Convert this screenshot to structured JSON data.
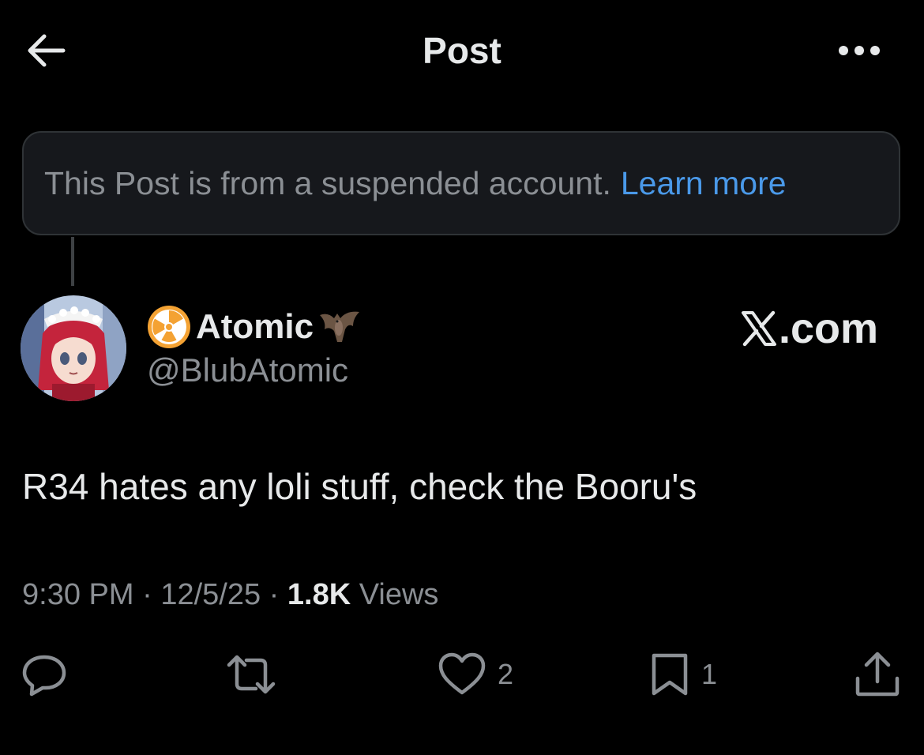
{
  "header": {
    "title": "Post"
  },
  "notice": {
    "text": "This Post is from a suspended account.",
    "link": "Learn more"
  },
  "author": {
    "display_name": "Atomic",
    "handle": "@BlubAtomic",
    "name_emoji_left": "radioactive-icon",
    "name_emoji_right": "bat-icon"
  },
  "brand": {
    "label": ".com"
  },
  "post": {
    "text": "R34 hates any loli stuff, check the Booru's",
    "time": "9:30 PM",
    "date": "12/5/25",
    "views_count": "1.8K",
    "views_label": "Views",
    "separator": "·"
  },
  "actions": {
    "likes": "2",
    "bookmarks": "1"
  },
  "colors": {
    "background": "#000000",
    "text_primary": "#e7e9ea",
    "text_secondary": "#8b8f94",
    "link": "#4a99e9",
    "notice_bg": "#16181c",
    "notice_border": "#2f3336"
  }
}
